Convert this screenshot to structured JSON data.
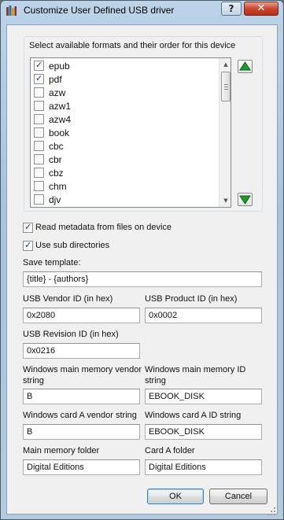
{
  "window": {
    "title": "Customize User Defined USB driver",
    "help_label": "?",
    "close_label": "✕"
  },
  "formats": {
    "group_label": "Select available formats and their order for this device",
    "items": [
      {
        "label": "epub",
        "checked": true
      },
      {
        "label": "pdf",
        "checked": true
      },
      {
        "label": "azw",
        "checked": false
      },
      {
        "label": "azw1",
        "checked": false
      },
      {
        "label": "azw4",
        "checked": false
      },
      {
        "label": "book",
        "checked": false
      },
      {
        "label": "cbc",
        "checked": false
      },
      {
        "label": "cbr",
        "checked": false
      },
      {
        "label": "cbz",
        "checked": false
      },
      {
        "label": "chm",
        "checked": false
      },
      {
        "label": "djv",
        "checked": false
      }
    ]
  },
  "options": {
    "read_metadata": {
      "label": "Read metadata from files on device",
      "checked": true
    },
    "use_subdirs": {
      "label": "Use sub directories",
      "checked": true
    }
  },
  "fields": {
    "save_template": {
      "label": "Save template:",
      "value": "{title} - {authors}"
    },
    "usb_vendor_id": {
      "label": "USB Vendor ID (in hex)",
      "value": "0x2080"
    },
    "usb_product_id": {
      "label": "USB Product ID (in hex)",
      "value": "0x0002"
    },
    "usb_revision_id": {
      "label": "USB Revision ID (in hex)",
      "value": "0x0216"
    },
    "main_vendor": {
      "label_line1": "Windows main memory vendor",
      "label_line2": "string",
      "value": "B"
    },
    "main_id": {
      "label_line1": "Windows main memory ID",
      "label_line2": "string",
      "value": "EBOOK_DISK"
    },
    "card_vendor": {
      "label": "Windows card A vendor string",
      "value": "B"
    },
    "card_id": {
      "label": "Windows card A ID string",
      "value": "EBOOK_DISK"
    },
    "main_folder": {
      "label": "Main memory folder",
      "value": "Digital Editions"
    },
    "card_folder": {
      "label": "Card A folder",
      "value": "Digital Editions"
    }
  },
  "buttons": {
    "ok": "OK",
    "cancel": "Cancel"
  },
  "colors": {
    "move_arrow": "#1f9a2a"
  }
}
